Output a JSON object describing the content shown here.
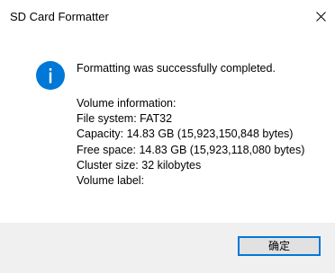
{
  "window": {
    "title": "SD Card Formatter",
    "close_icon": "close-icon"
  },
  "dialog": {
    "icon": "info-icon",
    "accent_color": "#0078d7",
    "message": "Formatting was successfully completed.",
    "details": [
      "Volume information:",
      "File system: FAT32",
      "Capacity: 14.83 GB (15,923,150,848 bytes)",
      "Free space: 14.83 GB (15,923,118,080 bytes)",
      "Cluster size: 32 kilobytes",
      "Volume label:"
    ]
  },
  "footer": {
    "ok_label": "确定"
  }
}
